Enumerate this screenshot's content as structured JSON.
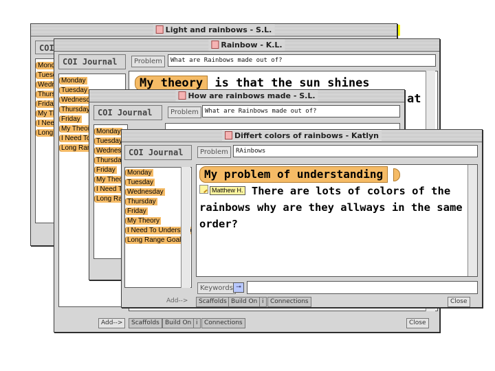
{
  "windows": {
    "w1": {
      "title": "Light and  rainbows - S.L.",
      "coi_header": "COI",
      "list_items": [
        "Monday",
        "Tuesday",
        "Wednesday",
        "Thursday",
        "Friday",
        "My Theory",
        "I Need To Understand",
        "Long Range Goal"
      ]
    },
    "w2": {
      "title": "Rainbow - K.L.",
      "coi_header": "COI Journal",
      "problem_label": "Problem",
      "problem_value": "What are Rainbows made out of?",
      "heading": "My theory",
      "body_text": "is that the sun shines",
      "trailing_text": "at",
      "list_items": [
        "Monday",
        "Tuesday",
        "Wednesday",
        "Thursday",
        "Friday",
        "My Theory",
        "I Need To Understand",
        "Long Range Goal"
      ],
      "add_button": "Add-->",
      "scaffolds_button": "Scaffolds",
      "build_on_button": "Build On",
      "info_button": "i",
      "connections_button": "Connections",
      "close_button": "Close"
    },
    "w3": {
      "title": "How are rainbows made - S.L.",
      "coi_header": "COI Journal",
      "problem_label": "Problem",
      "problem_value": "What are Rainbows made out of?",
      "list_items": [
        "Monday",
        "Tuesday",
        "Wednesday",
        "Thursday",
        "Friday",
        "My Theory",
        "I Need To Understand",
        "Long Range Goal"
      ]
    },
    "w4": {
      "title": "Differt colors of rainbows - Katlyn",
      "coi_header": "COI Journal",
      "problem_label": "Problem",
      "problem_value": "RAinbows",
      "heading": "My problem  of understanding",
      "author": "Matthew H.",
      "body_text": "There are lots of colors of the rainbows why are they allways in the same order?",
      "list_items": [
        "Monday",
        "Tuesday",
        "Wednesday",
        "Thursday",
        "Friday",
        "My Theory",
        "I Need To Understand",
        "Long Range Goal"
      ],
      "keywords_label": "Keywords",
      "add_button": "Add-->",
      "scaffolds_button": "Scaffolds",
      "build_on_button": "Build On",
      "info_button": "i",
      "connections_button": "Connections",
      "close_button": "Close"
    }
  }
}
